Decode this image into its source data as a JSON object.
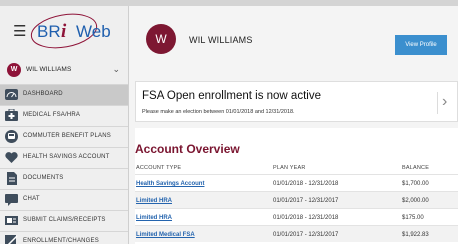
{
  "brand": {
    "name": "BRi Web",
    "accent": "#1f5fae",
    "italic_color": "#8e1338"
  },
  "user": {
    "initial": "W",
    "name": "WIL WILLIAMS",
    "avatar_color": "#7d1732"
  },
  "sidebar": {
    "items": [
      {
        "label": "DASHBOARD",
        "icon": "dashboard-icon",
        "active": true
      },
      {
        "label": "MEDICAL FSA/HRA",
        "icon": "medical-icon"
      },
      {
        "label": "COMMUTER BENEFIT PLANS",
        "icon": "commuter-icon"
      },
      {
        "label": "HEALTH SAVINGS ACCOUNT",
        "icon": "heart-icon"
      },
      {
        "label": "DOCUMENTS",
        "icon": "document-icon"
      },
      {
        "label": "CHAT",
        "icon": "chat-icon"
      },
      {
        "label": "SUBMIT CLAIMS/RECEIPTS",
        "icon": "claims-icon"
      },
      {
        "label": "ENROLLMENT/CHANGES",
        "icon": "enrollment-icon"
      }
    ]
  },
  "header": {
    "view_profile_label": "View Profile",
    "button_color": "#3b8fce"
  },
  "enrollment": {
    "title": "FSA Open enrollment is now active",
    "subtitle": "Please make an election between 01/01/2018 and 12/31/2018."
  },
  "overview": {
    "title": "Account Overview",
    "columns": [
      "ACCOUNT TYPE",
      "PLAN YEAR",
      "BALANCE"
    ],
    "rows": [
      {
        "account": "Health Savings Account",
        "plan_year": "01/01/2018 - 12/31/2018",
        "balance": "$1,700.00"
      },
      {
        "account": "Limited HRA",
        "plan_year": "01/01/2017 - 12/31/2017",
        "balance": "$2,000.00"
      },
      {
        "account": "Limited HRA",
        "plan_year": "01/01/2018 - 12/31/2018",
        "balance": "$175.00"
      },
      {
        "account": "Limited Medical FSA",
        "plan_year": "01/01/2017 - 12/31/2017",
        "balance": "$1,922.83"
      }
    ]
  }
}
